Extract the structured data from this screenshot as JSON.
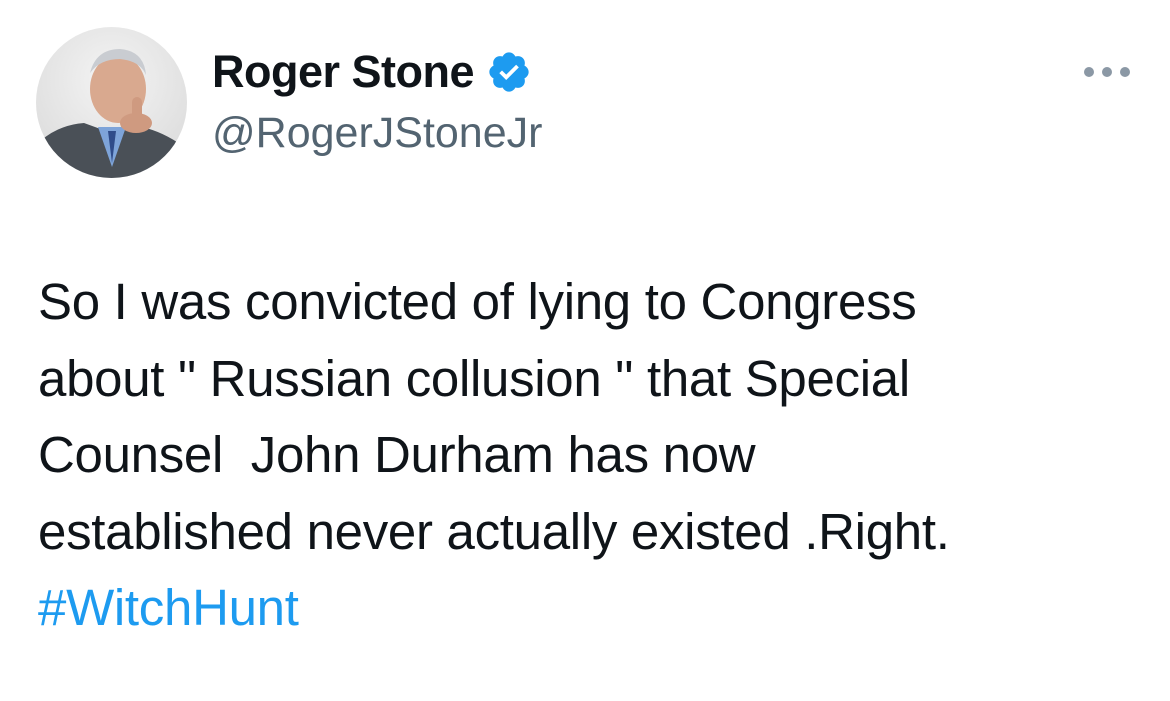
{
  "author": {
    "display_name": "Roger Stone",
    "handle": "@RogerJStoneJr",
    "verified": true,
    "avatar_icon": "profile-photo"
  },
  "tweet": {
    "lines": [
      "So I was convicted of lying to Congress",
      "about \" Russian collusion \" that Special",
      "Counsel  John Durham has now",
      "established never actually existed .Right."
    ],
    "hashtag": "#WitchHunt"
  },
  "menu": {
    "icon": "more-options-icon"
  },
  "colors": {
    "text": "#0f1419",
    "secondary": "#536471",
    "link": "#1d9bf0",
    "verified_badge": "#1d9bf0",
    "more_dots": "#8b98a5"
  }
}
